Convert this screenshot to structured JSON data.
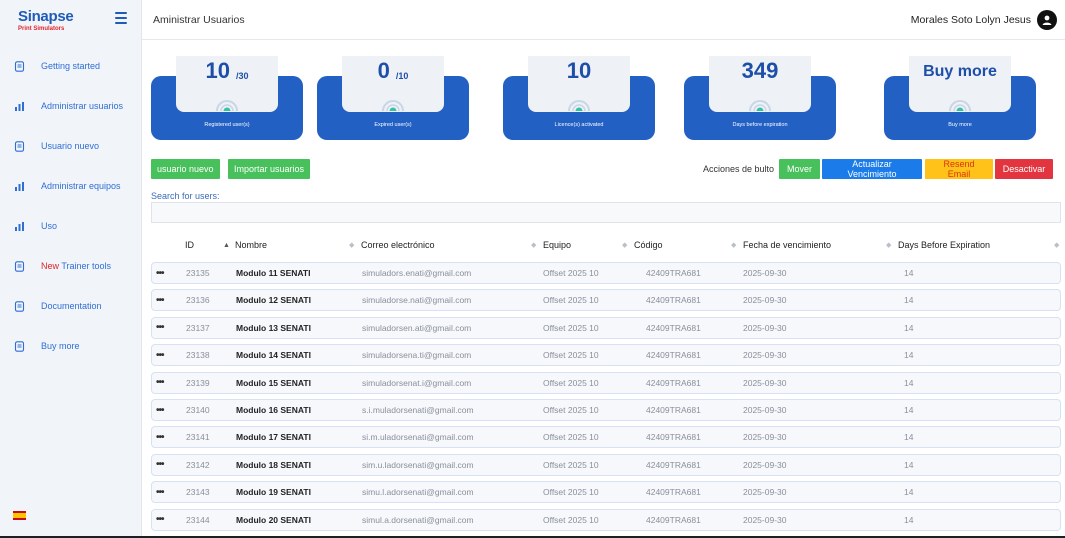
{
  "app": {
    "logo_main": "Sinapse",
    "logo_sub": "Print Simulators"
  },
  "header": {
    "title": "Aministrar Usuarios",
    "user_name": "Morales Soto Lolyn Jesus"
  },
  "sidebar": {
    "items": [
      {
        "label": "Getting started",
        "icon": "document-icon"
      },
      {
        "label": "Administrar usuarios",
        "icon": "bar-chart-icon"
      },
      {
        "label": "Usuario nuevo",
        "icon": "document-icon"
      },
      {
        "label": "Administrar equipos",
        "icon": "bar-chart-icon"
      },
      {
        "label": "Uso",
        "icon": "bar-chart-icon"
      },
      {
        "label_highlight": "New",
        "label": " Trainer tools",
        "icon": "document-icon"
      },
      {
        "label": "Documentation",
        "icon": "document-icon"
      },
      {
        "label": "Buy more",
        "icon": "document-icon"
      }
    ],
    "language_flag": "spain-flag-icon"
  },
  "stats": [
    {
      "value": "10",
      "denom": "/30",
      "caption": "Registered user(s)"
    },
    {
      "value": "0",
      "denom": "/10",
      "caption": "Expired user(s)"
    },
    {
      "value": "10",
      "denom": "",
      "caption": "Licence(s) activated"
    },
    {
      "value": "349",
      "denom": "",
      "caption": "Days before expiration"
    },
    {
      "value": "Buy more",
      "denom": "",
      "caption": "Buy more"
    }
  ],
  "toolbar": {
    "new_user": "usuario nuevo",
    "import_users": "Importar usuarios",
    "bulk_label": "Acciones de bulto",
    "move": "Mover",
    "update_expiration": "Actualizar Vencimiento",
    "resend_email": "Resend Email",
    "deactivate": "Desactivar"
  },
  "search": {
    "label": "Search for users:",
    "value": ""
  },
  "table": {
    "columns": [
      "ID",
      "Nombre",
      "Correo electrónico",
      "Equipo",
      "Código",
      "Fecha de vencimiento",
      "Days Before Expiration"
    ],
    "rows": [
      {
        "id": "23135",
        "name": "Modulo 11 SENATI",
        "email": "simuladors.enati@gmail.com",
        "team": "Offset 2025 10",
        "code": "42409TRA681",
        "expiry": "2025-09-30",
        "days": "14"
      },
      {
        "id": "23136",
        "name": "Modulo 12 SENATI",
        "email": "simuladorse.nati@gmail.com",
        "team": "Offset 2025 10",
        "code": "42409TRA681",
        "expiry": "2025-09-30",
        "days": "14"
      },
      {
        "id": "23137",
        "name": "Modulo 13 SENATI",
        "email": "simuladorsen.ati@gmail.com",
        "team": "Offset 2025 10",
        "code": "42409TRA681",
        "expiry": "2025-09-30",
        "days": "14"
      },
      {
        "id": "23138",
        "name": "Modulo 14 SENATI",
        "email": "simuladorsena.ti@gmail.com",
        "team": "Offset 2025 10",
        "code": "42409TRA681",
        "expiry": "2025-09-30",
        "days": "14"
      },
      {
        "id": "23139",
        "name": "Modulo 15 SENATI",
        "email": "simuladorsenat.i@gmail.com",
        "team": "Offset 2025 10",
        "code": "42409TRA681",
        "expiry": "2025-09-30",
        "days": "14"
      },
      {
        "id": "23140",
        "name": "Modulo 16 SENATI",
        "email": "s.i.muladorsenati@gmail.com",
        "team": "Offset 2025 10",
        "code": "42409TRA681",
        "expiry": "2025-09-30",
        "days": "14"
      },
      {
        "id": "23141",
        "name": "Modulo 17 SENATI",
        "email": "si.m.uladorsenati@gmail.com",
        "team": "Offset 2025 10",
        "code": "42409TRA681",
        "expiry": "2025-09-30",
        "days": "14"
      },
      {
        "id": "23142",
        "name": "Modulo 18 SENATI",
        "email": "sim.u.ladorsenati@gmail.com",
        "team": "Offset 2025 10",
        "code": "42409TRA681",
        "expiry": "2025-09-30",
        "days": "14"
      },
      {
        "id": "23143",
        "name": "Modulo 19 SENATI",
        "email": "simu.l.adorsenati@gmail.com",
        "team": "Offset 2025 10",
        "code": "42409TRA681",
        "expiry": "2025-09-30",
        "days": "14"
      },
      {
        "id": "23144",
        "name": "Modulo 20 SENATI",
        "email": "simul.a.dorsenati@gmail.com",
        "team": "Offset 2025 10",
        "code": "42409TRA681",
        "expiry": "2025-09-30",
        "days": "14"
      }
    ]
  },
  "colors": {
    "brand_blue": "#1e5cb8",
    "card_blue": "#2260c4",
    "green": "#48c15c",
    "blue_button": "#1a7be9",
    "yellow_button": "#ffc218",
    "red_button": "#e33540"
  }
}
